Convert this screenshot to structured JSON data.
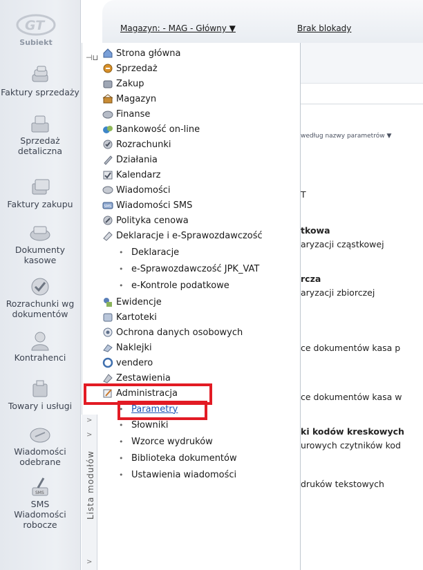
{
  "app": {
    "brand": "Subiekt"
  },
  "header": {
    "warehouse_link": "Magazyn: - MAG - Główny ▼",
    "lock_link": "Brak blokady"
  },
  "left_bar": {
    "items": [
      {
        "label": "Faktury sprzedaży",
        "icon": "coins-stack-icon"
      },
      {
        "label": "Sprzedaż detaliczna",
        "icon": "cash-register-icon"
      },
      {
        "label": "Faktury zakupu",
        "icon": "invoice-stack-icon"
      },
      {
        "label": "Dokumenty kasowe",
        "icon": "cash-document-icon"
      },
      {
        "label": "Rozrachunki wg dokumentów",
        "icon": "settlement-check-icon"
      },
      {
        "label": "Kontrahenci",
        "icon": "person-icon"
      },
      {
        "label": "Towary i usługi",
        "icon": "goods-box-icon"
      },
      {
        "label": "Wiadomości odebrane",
        "icon": "message-icon"
      },
      {
        "label": "SMS Wiadomości robocze",
        "icon": "sms-pen-icon"
      }
    ]
  },
  "module_panel": {
    "vertical_tab_label": "Lista modułów",
    "modules": [
      {
        "label": "Strona główna",
        "icon": "home-icon"
      },
      {
        "label": "Sprzedaż",
        "icon": "sales-icon"
      },
      {
        "label": "Zakup",
        "icon": "purchase-icon"
      },
      {
        "label": "Magazyn",
        "icon": "warehouse-icon"
      },
      {
        "label": "Finanse",
        "icon": "finance-icon"
      },
      {
        "label": "Bankowość on-line",
        "icon": "bank-icon"
      },
      {
        "label": "Rozrachunki",
        "icon": "settlement-icon"
      },
      {
        "label": "Działania",
        "icon": "actions-icon"
      },
      {
        "label": "Kalendarz",
        "icon": "calendar-icon"
      },
      {
        "label": "Wiadomości",
        "icon": "messages-icon"
      },
      {
        "label": "Wiadomości SMS",
        "icon": "sms-icon"
      },
      {
        "label": "Polityka cenowa",
        "icon": "pricing-icon"
      },
      {
        "label": "Deklaracje i e-Sprawozdawczość",
        "icon": "declarations-icon"
      }
    ],
    "declarations_sub": [
      "Deklaracje",
      "e-Sprawozdawczość JPK_VAT",
      "e-Kontrole podatkowe"
    ],
    "modules_2": [
      {
        "label": "Ewidencje",
        "icon": "records-icon"
      },
      {
        "label": "Kartoteki",
        "icon": "files-icon"
      },
      {
        "label": "Ochrona danych osobowych",
        "icon": "data-protection-icon"
      },
      {
        "label": "Naklejki",
        "icon": "stickers-icon"
      },
      {
        "label": "vendero",
        "icon": "vendero-icon"
      },
      {
        "label": "Zestawienia",
        "icon": "reports-icon"
      },
      {
        "label": "Administracja",
        "icon": "administration-icon"
      }
    ],
    "admin_sub": [
      "Parametry",
      "Słowniki",
      "Wzorce wydruków",
      "Biblioteka dokumentów",
      "Ustawienia wiadomości"
    ]
  },
  "content": {
    "sort_label": "według nazwy parametrów ▼",
    "rows": [
      {
        "text": "T",
        "bold": false
      },
      {
        "text": "tkowa",
        "bold": true
      },
      {
        "text": "aryzacji cząstkowej",
        "bold": false
      },
      {
        "text": "rcza",
        "bold": true
      },
      {
        "text": "aryzacji zbiorczej",
        "bold": false
      },
      {
        "text": "ce dokumentów kasa p",
        "bold": false
      },
      {
        "text": "ce dokumentów kasa w",
        "bold": false
      },
      {
        "text": "ki kodów kreskowych",
        "bold": true
      },
      {
        "text": "urowych czytników kod",
        "bold": false
      },
      {
        "text": "druków tekstowych",
        "bold": false
      }
    ]
  },
  "colors": {
    "highlight": "#e21b24",
    "link": "#1c54b4"
  }
}
